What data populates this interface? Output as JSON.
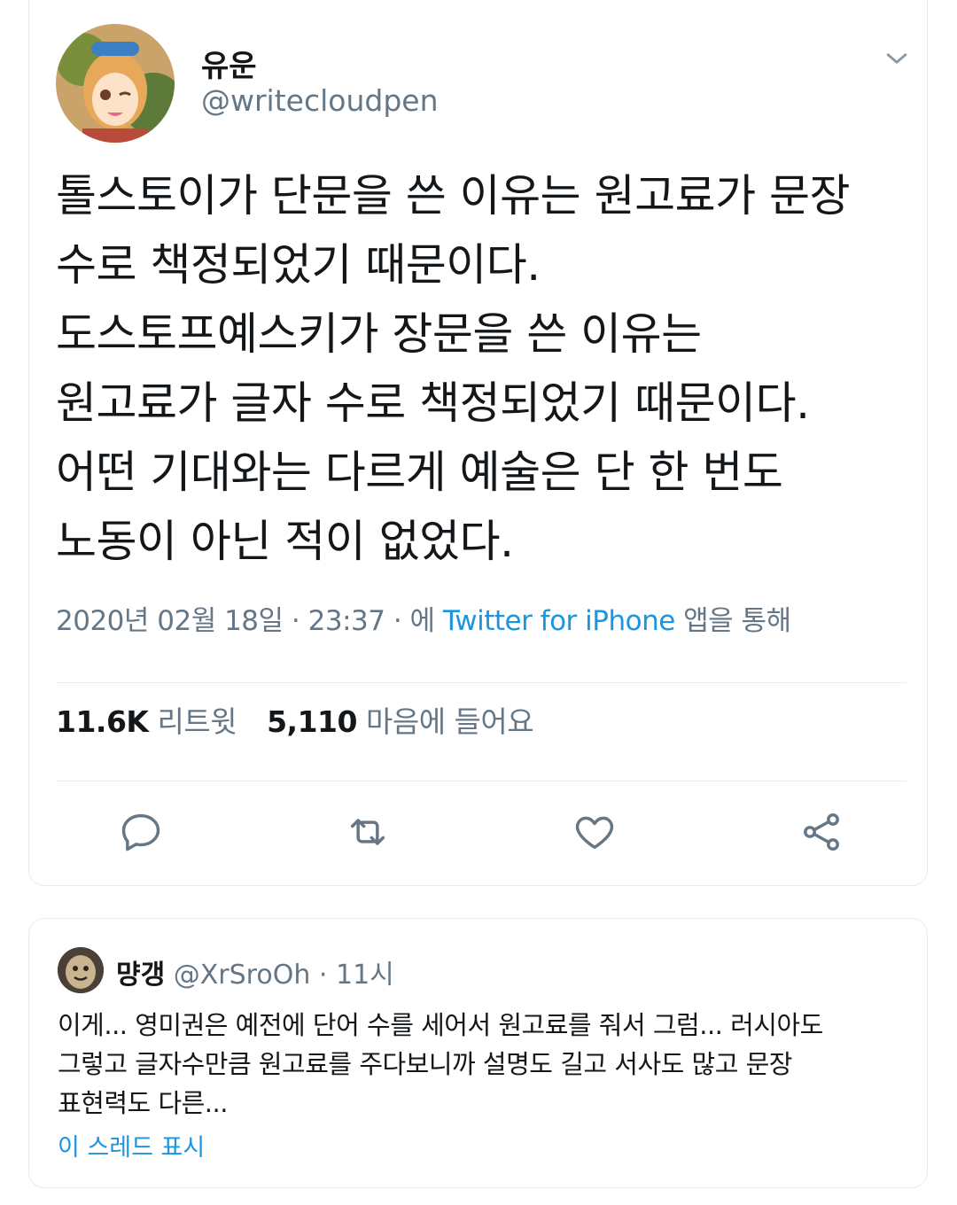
{
  "tweet": {
    "author_name": "유운",
    "author_handle": "@writecloudpen",
    "text": "톨스토이가 단문을 쓴 이유는 원고료가 문장\n수로 책정되었기 때문이다.\n도스토프예스키가 장문을 쓴 이유는\n원고료가 글자 수로 책정되었기 때문이다.\n어떤 기대와는 다르게 예술은 단 한 번도\n노동이 아닌 적이 없었다.",
    "date": "2020년 02월 18일",
    "time": "23:37",
    "via_prefix": "에",
    "source_app": "Twitter for iPhone",
    "via_suffix": "앱을 통해",
    "retweets": "11.6K",
    "retweets_label": "리트윗",
    "likes": "5,110",
    "likes_label": "마음에 들어요"
  },
  "reply": {
    "name": "먕갱",
    "handle": "@XrSroOh",
    "time": "11시",
    "text": "이게... 영미권은 예전에 단어 수를 세어서 원고료를 줘서 그럼... 러시아도\n그렇고 글자수만큼 원고료를 주다보니까 설명도 길고 서사도 많고 문장\n표현력도 다른...",
    "show_thread": "이 스레드 표시"
  },
  "icons": {
    "chevron": "chevron-down-icon",
    "reply": "reply-icon",
    "retweet": "retweet-icon",
    "like": "heart-icon",
    "share": "share-icon"
  },
  "colors": {
    "link": "#1b95e0",
    "secondary_text": "#657786",
    "divider": "#e6ecf0"
  }
}
